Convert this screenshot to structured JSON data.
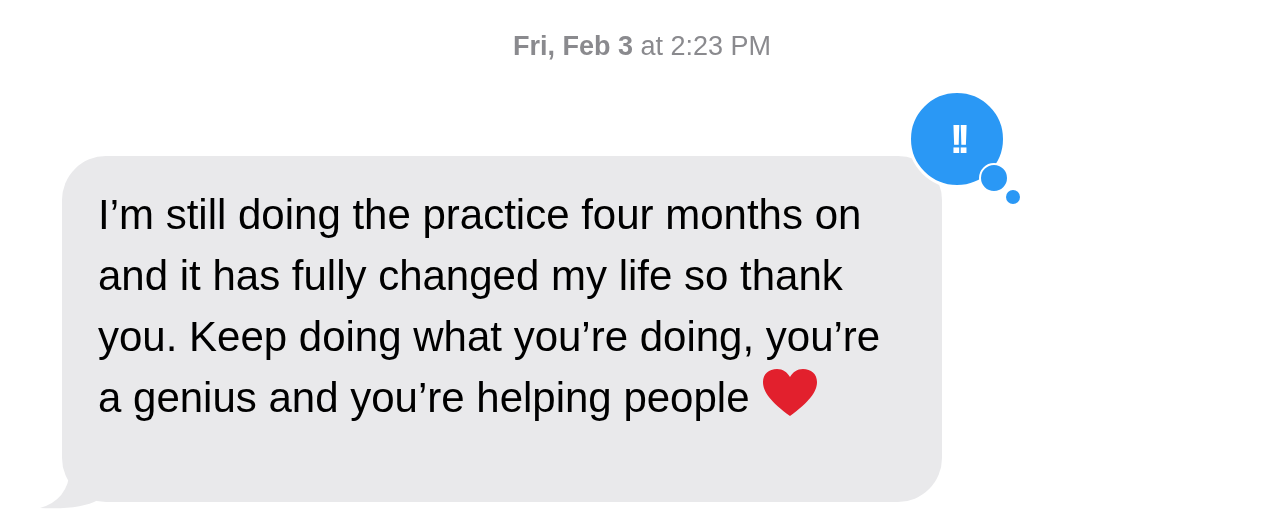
{
  "timestamp": "**Fri, Feb 3** at 2:23 PM",
  "message": {
    "text": "I’m still doing the practice four months on and it has fully changed my life so thank you. Keep doing what you’re doing, you’re a genius and you’re helping people",
    "reaction": "!!"
  }
}
